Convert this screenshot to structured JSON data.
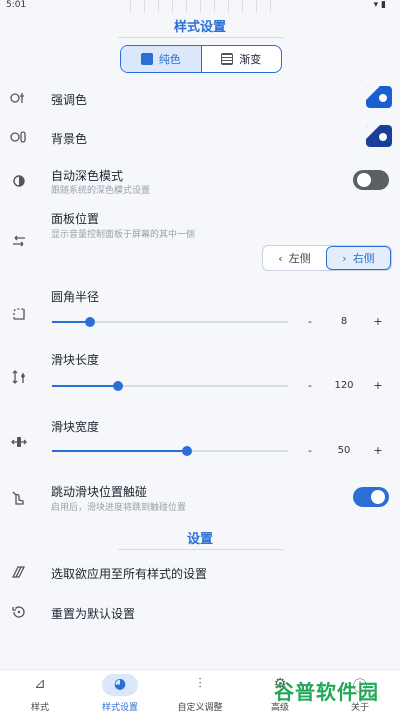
{
  "status": {
    "time": "5:01",
    "right": "▾ ▮"
  },
  "header": {
    "title": "样式设置"
  },
  "mode_tabs": [
    {
      "label": "纯色",
      "active": true,
      "icon": "solid-square-icon"
    },
    {
      "label": "渐变",
      "active": false,
      "icon": "gradient-square-icon"
    }
  ],
  "rows": {
    "accent": {
      "label": "强调色"
    },
    "background": {
      "label": "背景色"
    },
    "dark": {
      "label": "自动深色模式",
      "sub": "跟随系统的深色模式设置",
      "on": false
    },
    "panel_pos": {
      "label": "面板位置",
      "sub": "显示音量控制面板于屏幕的其中一侧",
      "left": "左侧",
      "right": "右侧",
      "selected": "右侧"
    },
    "corner": {
      "label": "圆角半径",
      "value": "8",
      "fraction": 0.16
    },
    "slider_len": {
      "label": "滑块长度",
      "value": "120",
      "fraction": 0.28
    },
    "slider_w": {
      "label": "滑块宽度",
      "value": "50",
      "fraction": 0.57
    },
    "jump": {
      "label": "跳动滑块位置触碰",
      "sub": "启用后，滑块进度将跳到触碰位置",
      "on": true
    }
  },
  "settings_section": {
    "title": "设置"
  },
  "actions": [
    {
      "label": "选取欲应用至所有样式的设置"
    },
    {
      "label": "重置为默认设置"
    }
  ],
  "stepper": {
    "minus": "-",
    "plus": "+"
  },
  "nav": [
    {
      "label": "样式",
      "icon": "brush-icon"
    },
    {
      "label": "样式设置",
      "icon": "palette-icon",
      "active": true
    },
    {
      "label": "自定义调整",
      "icon": "sliders-icon"
    },
    {
      "label": "高级",
      "icon": "gear-icon"
    },
    {
      "label": "关于",
      "icon": "info-icon"
    }
  ],
  "watermark": "谷普软件园",
  "colors": {
    "accent": "#2b6fd6",
    "accent_swatch": "#1a5fd1",
    "bg_swatch": "#1a3f9a"
  }
}
